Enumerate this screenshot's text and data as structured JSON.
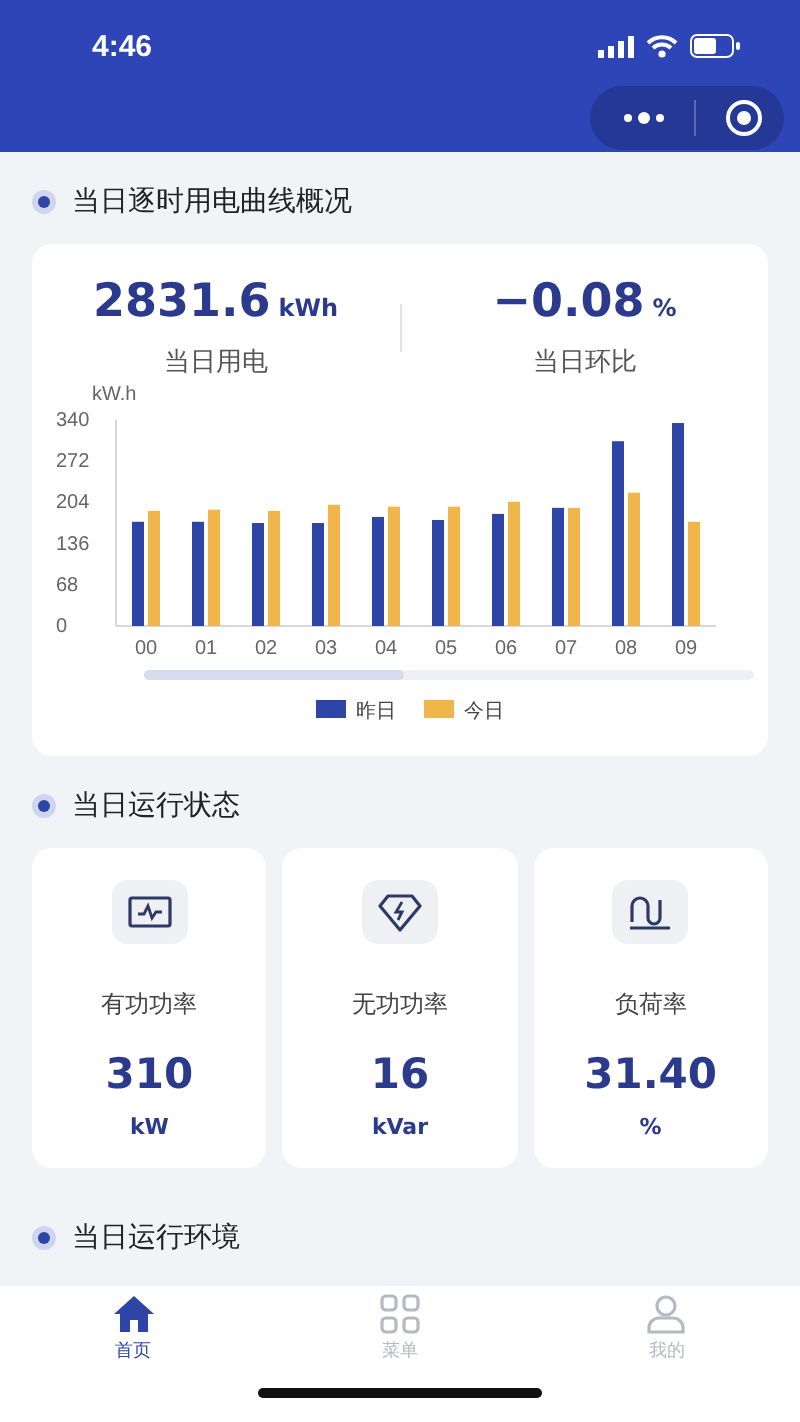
{
  "status_bar": {
    "time": "4:46"
  },
  "sections": [
    {
      "title": "当日逐时用电曲线概况"
    },
    {
      "title": "当日运行状态"
    },
    {
      "title": "当日运行环境"
    }
  ],
  "summary": [
    {
      "value": "2831.6",
      "unit": "kWh",
      "label": "当日用电"
    },
    {
      "value": "−0.08",
      "unit": "%",
      "label": "当日环比"
    }
  ],
  "chart_data": {
    "type": "bar",
    "legend": "bottom",
    "ylabel": "kW.h",
    "categories": [
      "00",
      "01",
      "02",
      "03",
      "04",
      "05",
      "06",
      "07",
      "08",
      "09"
    ],
    "ylim": [
      0,
      340
    ],
    "yticks": [
      0,
      68,
      136,
      204,
      272,
      340
    ],
    "series": [
      {
        "name": "昨日",
        "color": "#2e45a8",
        "values": [
          172,
          172,
          170,
          170,
          180,
          175,
          185,
          195,
          305,
          335
        ]
      },
      {
        "name": "今日",
        "color": "#f0b64a",
        "values": [
          190,
          192,
          190,
          200,
          197,
          197,
          205,
          195,
          220,
          172
        ]
      }
    ]
  },
  "stats": [
    {
      "label": "有功功率",
      "value": "310",
      "unit": "kW"
    },
    {
      "label": "无功功率",
      "value": "16",
      "unit": "kVar"
    },
    {
      "label": "负荷率",
      "value": "31.40",
      "unit": "%"
    }
  ],
  "tabs": [
    {
      "label": "首页",
      "selected": true
    },
    {
      "label": "菜单",
      "selected": false
    },
    {
      "label": "我的",
      "selected": false
    }
  ]
}
